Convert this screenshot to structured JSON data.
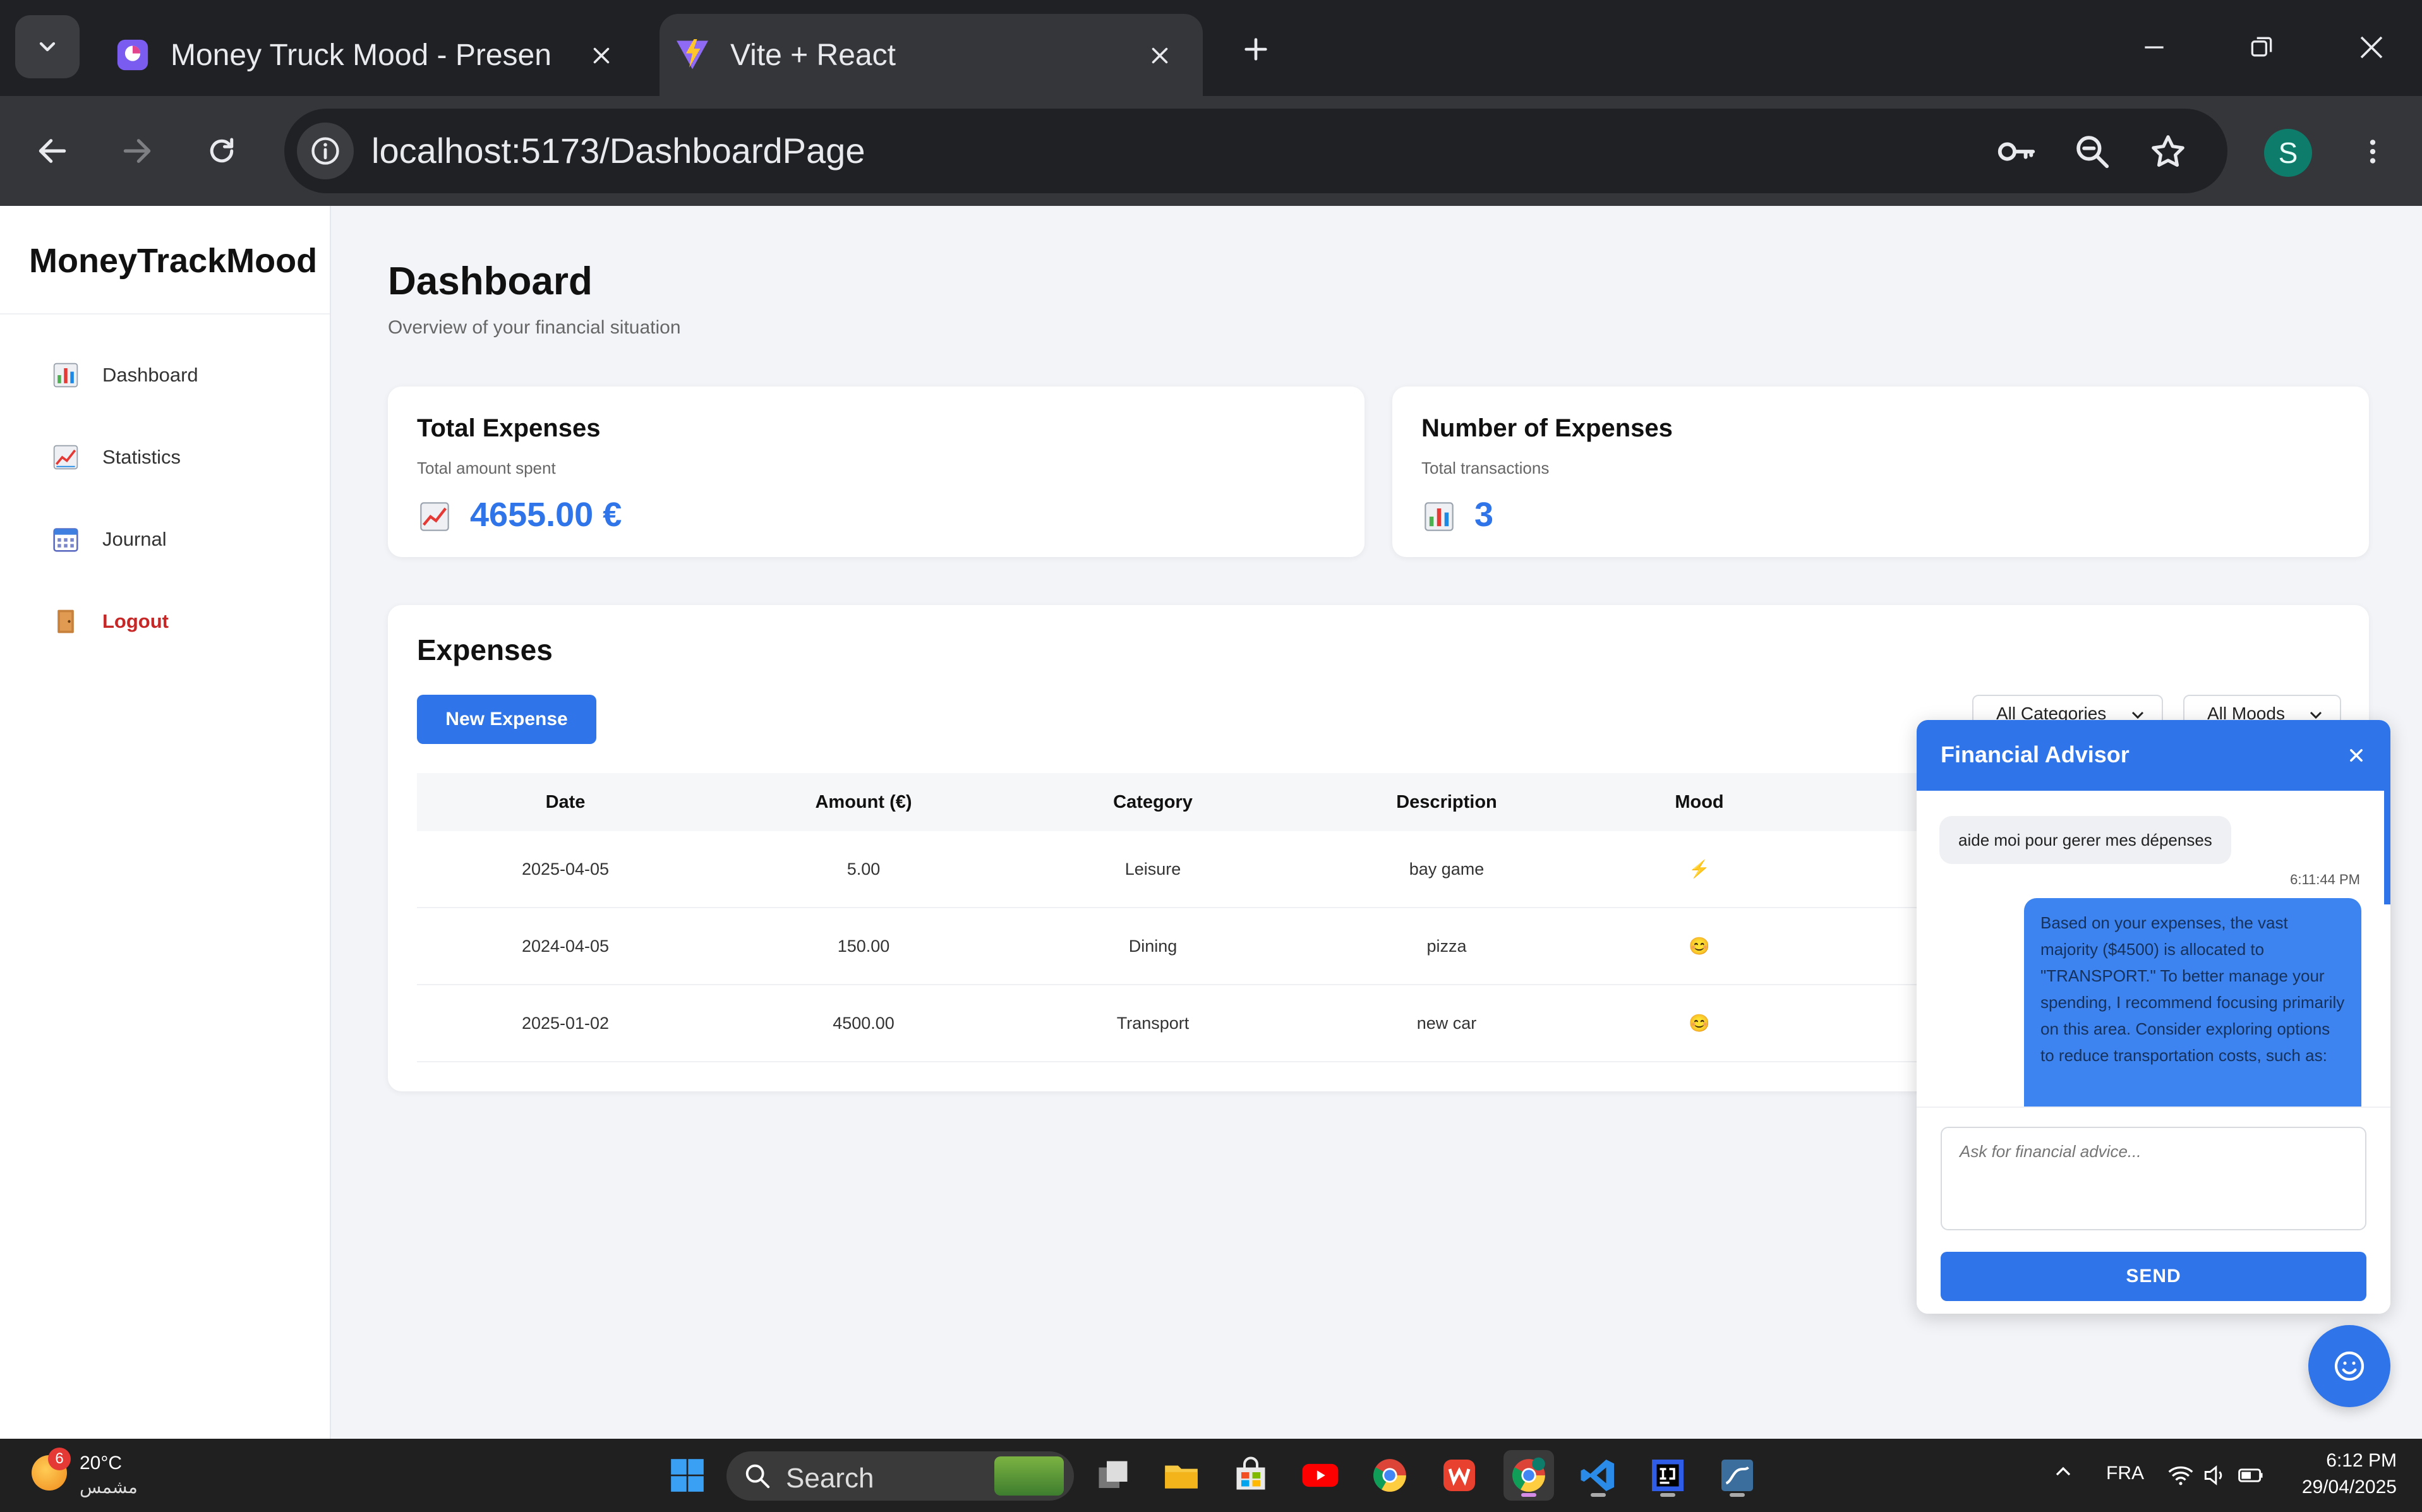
{
  "browser": {
    "tabs": [
      {
        "title": "Money Truck Mood - Presentati",
        "active": false
      },
      {
        "title": "Vite + React",
        "active": true
      }
    ],
    "url": "localhost:5173/DashboardPage",
    "profile_initial": "S"
  },
  "app": {
    "brand": "MoneyTrackMood",
    "nav": [
      {
        "label": "Dashboard",
        "icon": "bar-chart-icon"
      },
      {
        "label": "Statistics",
        "icon": "trend-chart-icon"
      },
      {
        "label": "Journal",
        "icon": "calendar-icon"
      },
      {
        "label": "Logout",
        "icon": "door-icon"
      }
    ]
  },
  "page": {
    "title": "Dashboard",
    "subtitle": "Overview of your financial situation"
  },
  "cards": {
    "total": {
      "title": "Total Expenses",
      "subtitle": "Total amount spent",
      "value": "4655.00 €",
      "icon": "trend-chart-icon"
    },
    "count": {
      "title": "Number of Expenses",
      "subtitle": "Total transactions",
      "value": "3",
      "icon": "bar-chart-icon"
    }
  },
  "expenses": {
    "title": "Expenses",
    "new_button": "New Expense",
    "filters": {
      "category": "All Categories",
      "mood": "All Moods"
    },
    "columns": [
      "Date",
      "Amount (€)",
      "Category",
      "Description",
      "Mood"
    ],
    "rows": [
      {
        "date": "2025-04-05",
        "amount": "5.00",
        "category": "Leisure",
        "description": "bay game",
        "mood": "⚡"
      },
      {
        "date": "2024-04-05",
        "amount": "150.00",
        "category": "Dining",
        "description": "pizza",
        "mood": "😊"
      },
      {
        "date": "2025-01-02",
        "amount": "4500.00",
        "category": "Transport",
        "description": "new car",
        "mood": "😊"
      }
    ]
  },
  "chat": {
    "title": "Financial Advisor",
    "user_message": "aide moi pour gerer mes dépenses",
    "time": "6:11:44 PM",
    "bot_message": "Based on your expenses, the vast majority ($4500) is allocated to \"TRANSPORT.\" To better manage your spending, I recommend focusing primarily on this area. Consider exploring options to reduce transportation costs, such as:",
    "input_placeholder": "Ask for financial advice...",
    "send_label": "SEND"
  },
  "taskbar": {
    "weather_temp": "20°C",
    "weather_desc": "مشمس",
    "weather_badge": "6",
    "search_label": "Search",
    "language": "FRA",
    "time": "6:12 PM",
    "date": "29/04/2025"
  },
  "colors": {
    "accent": "#2f74e8",
    "logout": "#c62828",
    "chrome_dark": "#202124"
  }
}
